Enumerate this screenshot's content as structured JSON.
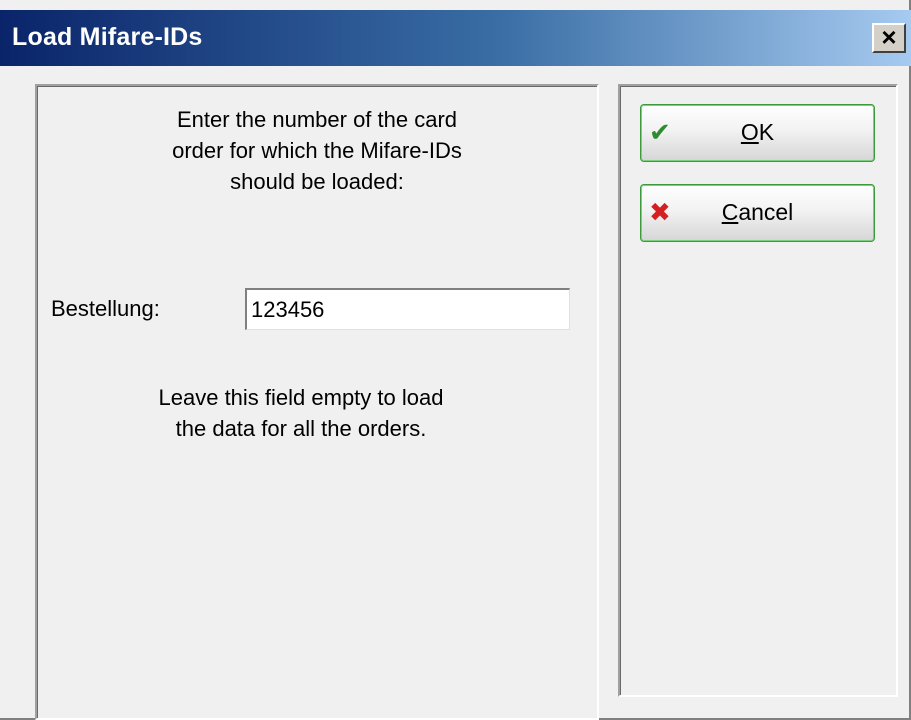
{
  "window": {
    "title": "Load Mifare-IDs",
    "close_label": "×"
  },
  "content": {
    "instruction": "Enter the number of the card\norder for which the Mifare-IDs\nshould be loaded:",
    "field_label": "Bestellung:",
    "field_value": "123456",
    "hint": "Leave this field empty to load\nthe data for all the orders."
  },
  "buttons": {
    "ok": {
      "mnemonic": "O",
      "rest": "K",
      "icon": "checkmark-icon"
    },
    "cancel": {
      "mnemonic": "C",
      "rest": "ancel",
      "icon": "x-mark-icon"
    }
  },
  "colors": {
    "title_start": "#0a246a",
    "title_end": "#a6caf0",
    "button_border": "#3c9a3c",
    "ok_icon": "#2e8b2e",
    "cancel_icon": "#d42020"
  }
}
